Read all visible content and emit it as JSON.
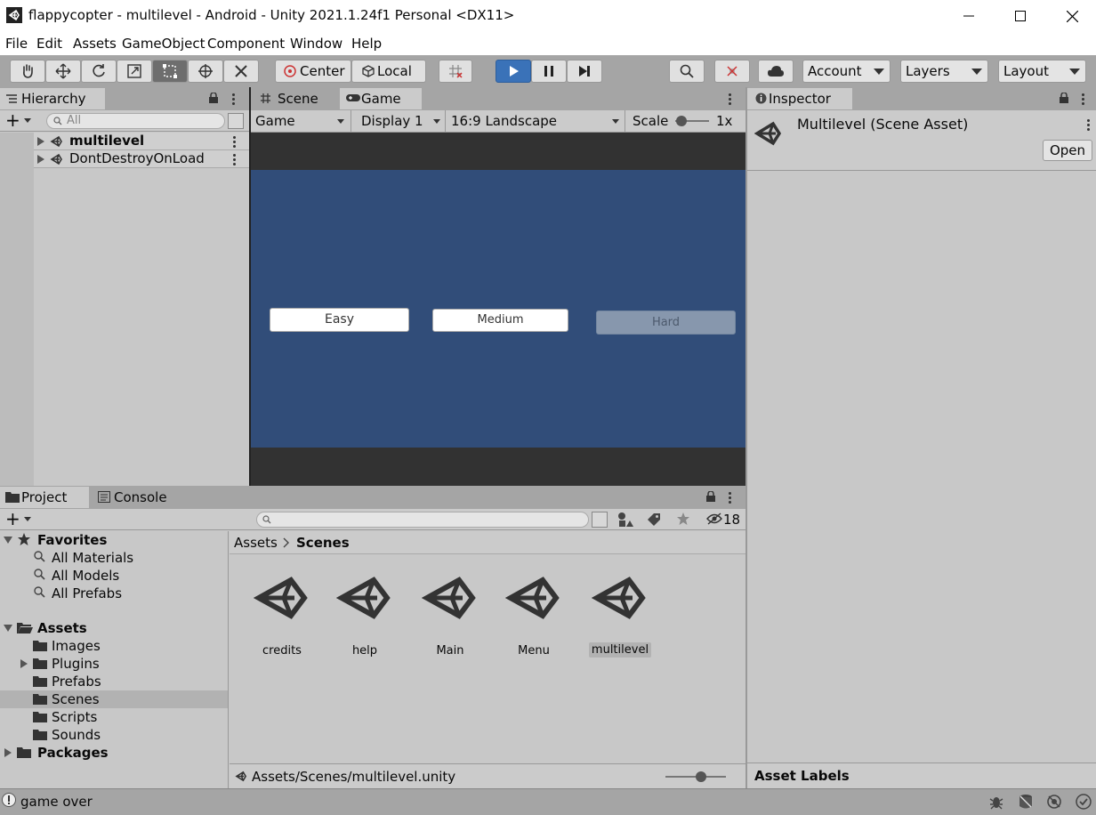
{
  "window": {
    "title": "flappycopter - multilevel - Android - Unity 2021.1.24f1 Personal <DX11>",
    "controls": [
      "minimize-icon",
      "maximize-icon",
      "close-icon"
    ]
  },
  "menu": [
    "File",
    "Edit",
    "Assets",
    "GameObject",
    "Component",
    "Window",
    "Help"
  ],
  "toolbar": {
    "pivot_label": "Center",
    "space_label": "Local",
    "account_label": "Account",
    "layers_label": "Layers",
    "layout_label": "Layout"
  },
  "hierarchy": {
    "tab_label": "Hierarchy",
    "search_placeholder": "All",
    "items": [
      "multilevel",
      "DontDestroyOnLoad"
    ]
  },
  "game_view": {
    "tabs": [
      "Scene",
      "Game"
    ],
    "mode": "Game",
    "display": "Display 1",
    "aspect": "16:9 Landscape",
    "scale_label": "Scale",
    "scale_value": "1x",
    "buttons": [
      "Easy",
      "Medium",
      "Hard"
    ],
    "colors": {
      "letterbox": "#323232",
      "game_bg": "#314d79",
      "button": "#ffffff",
      "button_disabled": "#8797ad"
    }
  },
  "inspector": {
    "tab_label": "Inspector",
    "asset_title": "Multilevel (Scene Asset)",
    "open_label": "Open",
    "asset_labels": "Asset Labels"
  },
  "project": {
    "tabs": [
      "Project",
      "Console"
    ],
    "hidden_count": "18",
    "favorites_label": "Favorites",
    "favorites": [
      "All Materials",
      "All Models",
      "All Prefabs"
    ],
    "assets_label": "Assets",
    "folders": [
      "Images",
      "Plugins",
      "Prefabs",
      "Scenes",
      "Scripts",
      "Sounds"
    ],
    "packages_label": "Packages",
    "breadcrumb": [
      "Assets",
      "Scenes"
    ],
    "scene_files": [
      "credits",
      "help",
      "Main",
      "Menu",
      "multilevel"
    ],
    "selected_path": "Assets/Scenes/multilevel.unity"
  },
  "status": {
    "message": "game over"
  },
  "colors": {
    "play_active": "#3a72b8",
    "toolbar_bg": "#a5a5a5",
    "panel_bg": "#c8c8c8"
  }
}
